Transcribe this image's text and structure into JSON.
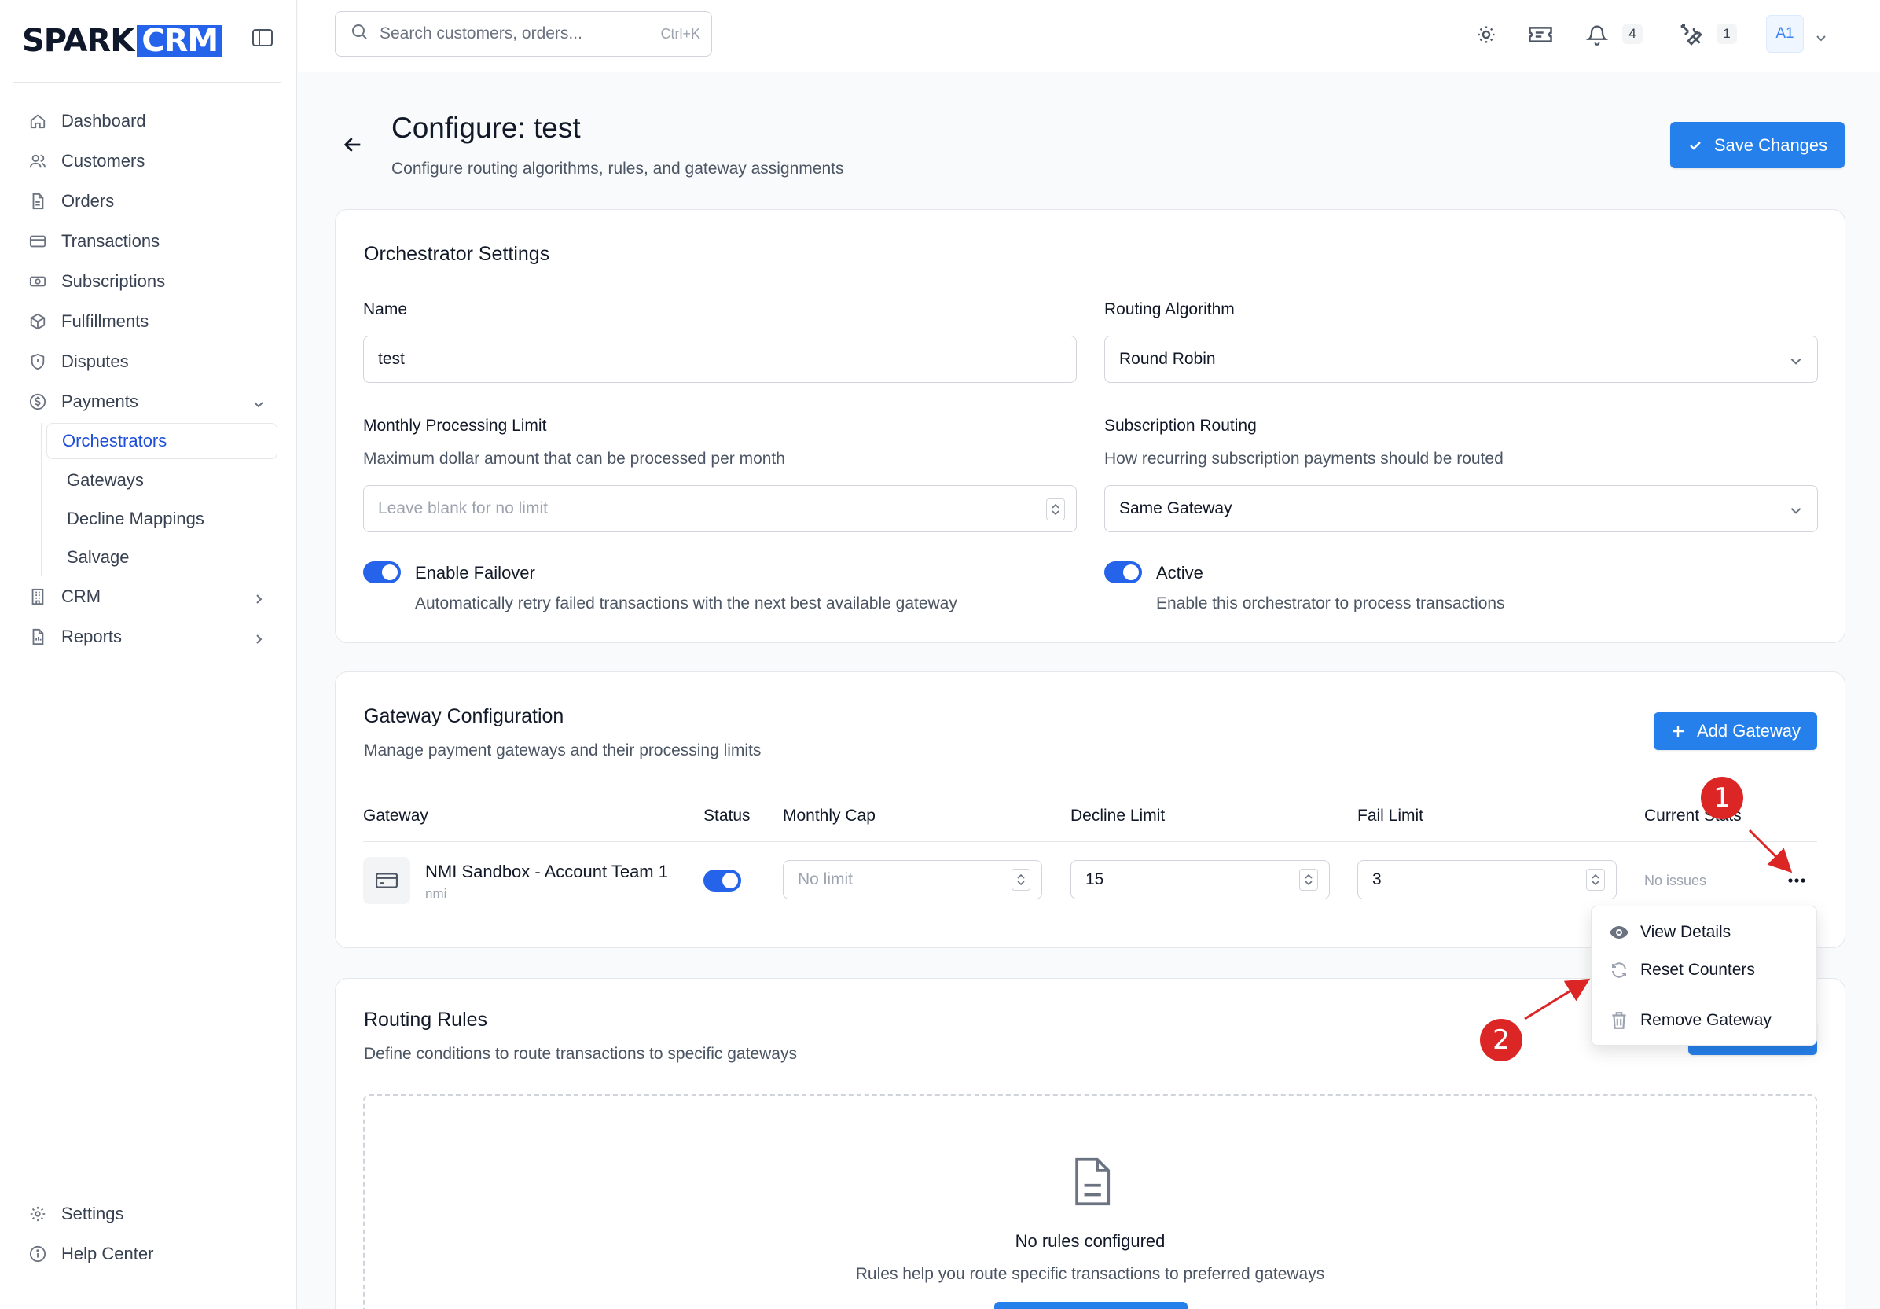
{
  "app": {
    "logo_left": "SPARK",
    "logo_right": "CRM"
  },
  "sidebar": {
    "items": [
      {
        "label": "Dashboard",
        "icon": "home-icon"
      },
      {
        "label": "Customers",
        "icon": "users-icon"
      },
      {
        "label": "Orders",
        "icon": "file-icon"
      },
      {
        "label": "Transactions",
        "icon": "credit-card-icon"
      },
      {
        "label": "Subscriptions",
        "icon": "banknote-icon"
      },
      {
        "label": "Fulfillments",
        "icon": "package-icon"
      },
      {
        "label": "Disputes",
        "icon": "shield-icon"
      },
      {
        "label": "Payments",
        "icon": "dollar-icon"
      }
    ],
    "payments_sub": [
      "Orchestrators",
      "Gateways",
      "Decline Mappings",
      "Salvage"
    ],
    "crm": "CRM",
    "reports": "Reports",
    "settings": "Settings",
    "help": "Help Center"
  },
  "topbar": {
    "search_placeholder": "Search customers, orders...",
    "search_shortcut": "Ctrl+K",
    "notifications_count": "4",
    "tools_count": "1",
    "avatar": "A1"
  },
  "page": {
    "title": "Configure: test",
    "subtitle": "Configure routing algorithms, rules, and gateway assignments",
    "save_label": "Save Changes"
  },
  "orchestrator": {
    "title": "Orchestrator Settings",
    "name_label": "Name",
    "name_value": "test",
    "algo_label": "Routing Algorithm",
    "algo_value": "Round Robin",
    "limit_label": "Monthly Processing Limit",
    "limit_help": "Maximum dollar amount that can be processed per month",
    "limit_placeholder": "Leave blank for no limit",
    "sub_label": "Subscription Routing",
    "sub_help": "How recurring subscription payments should be routed",
    "sub_value": "Same Gateway",
    "failover_label": "Enable Failover",
    "failover_help": "Automatically retry failed transactions with the next best available gateway",
    "active_label": "Active",
    "active_help": "Enable this orchestrator to process transactions"
  },
  "gateway_config": {
    "title": "Gateway Configuration",
    "desc": "Manage payment gateways and their processing limits",
    "add_label": "Add Gateway",
    "columns": [
      "Gateway",
      "Status",
      "Monthly Cap",
      "Decline Limit",
      "Fail Limit",
      "Current Stats"
    ],
    "row": {
      "name": "NMI Sandbox - Account Team 1",
      "type": "nmi",
      "monthly_cap_placeholder": "No limit",
      "decline_limit": "15",
      "fail_limit": "3",
      "stats": "No issues"
    },
    "menu": [
      "View Details",
      "Reset Counters",
      "Remove Gateway"
    ]
  },
  "routing_rules": {
    "title": "Routing Rules",
    "desc": "Define conditions to route transactions to specific gateways",
    "empty_title": "No rules configured",
    "empty_desc": "Rules help you route specific transactions to preferred gateways"
  },
  "annotations": [
    "1",
    "2"
  ],
  "colors": {
    "accent": "#2680eb",
    "annotation": "#dc2626"
  }
}
